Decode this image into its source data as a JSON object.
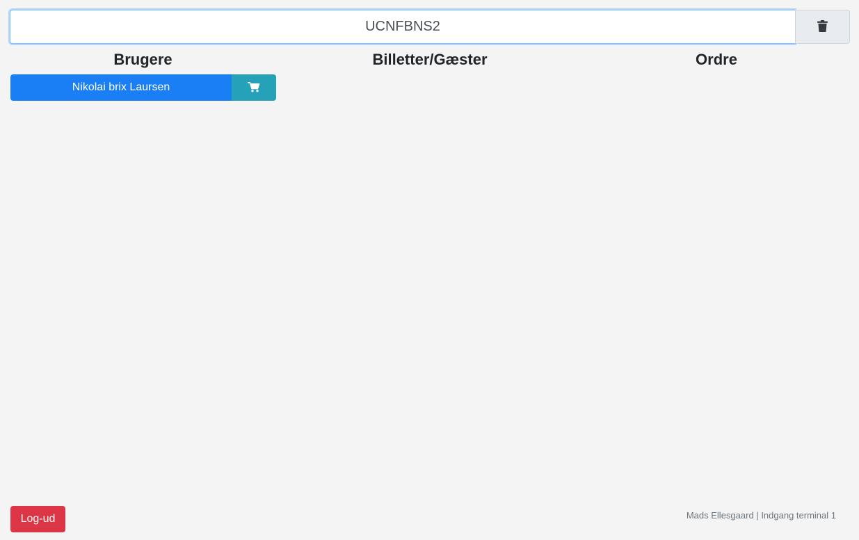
{
  "search": {
    "value": "UCNFBNS2",
    "clear_icon": "trash-icon"
  },
  "columns": {
    "users": "Brugere",
    "tickets": "Billetter/Gæster",
    "orders": "Ordre"
  },
  "users": [
    {
      "name": "Nikolai brix Laursen",
      "action_icon": "cart-icon"
    }
  ],
  "footer": {
    "logout_label": "Log-ud",
    "user_name": "Mads Ellesgaard",
    "separator": "|",
    "terminal": "Indgang terminal 1"
  },
  "colors": {
    "primary": "#1a7ff5",
    "info": "#25a2b8",
    "danger": "#dc3545",
    "background": "#f4f4f4"
  }
}
